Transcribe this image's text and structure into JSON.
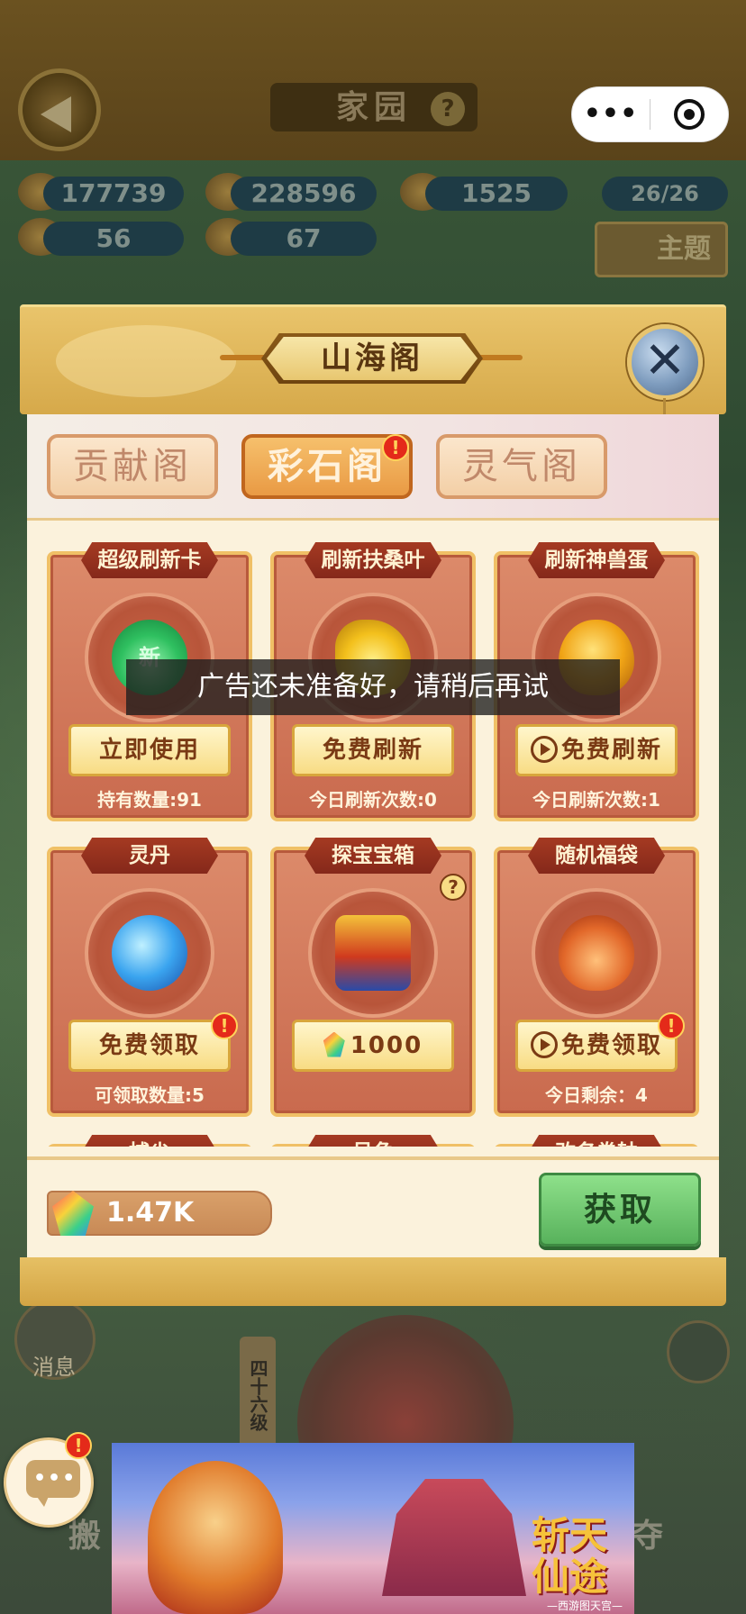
{
  "background": {
    "home_title": "家园",
    "help_glyph": "?",
    "capsule": {
      "more": "•••"
    },
    "resources": [
      "177739",
      "228596",
      "1525",
      "26/26",
      "56",
      "67"
    ],
    "theme_label": "主题",
    "message_label": "消息",
    "level_label": "四十六级",
    "left_action": "搬",
    "right_action": "夺"
  },
  "modal": {
    "title": "山海阁",
    "close_glyph": "✕",
    "tabs": [
      {
        "label": "贡献阁",
        "active": false
      },
      {
        "label": "彩石阁",
        "active": true,
        "badge": "!"
      },
      {
        "label": "灵气阁",
        "active": false
      }
    ],
    "items": [
      {
        "title": "超级刷新卡",
        "icon": "green-fire-icon",
        "tag": "新",
        "button": "立即使用",
        "footer": "持有数量:91"
      },
      {
        "title": "刷新扶桑叶",
        "icon": "golden-leaf-icon",
        "button": "免费刷新",
        "footer": "今日刷新次数:0"
      },
      {
        "title": "刷新神兽蛋",
        "icon": "golden-egg-icon",
        "button": "免费刷新",
        "button_icon": "play-video-icon",
        "footer": "今日刷新次数:1"
      },
      {
        "title": "灵丹",
        "icon": "blue-pill-icon",
        "button": "免费领取",
        "badge": "!",
        "footer": "可领取数量:5"
      },
      {
        "title": "探宝宝箱",
        "icon": "treasure-chest-icon",
        "button": "1000",
        "button_icon": "gem-icon",
        "help": "?",
        "footer": ""
      },
      {
        "title": "随机福袋",
        "icon": "lucky-bag-icon",
        "button": "免费领取",
        "button_icon": "play-video-icon",
        "badge": "!",
        "footer": "今日剩余：4"
      }
    ],
    "partial_titles": [
      "捕尘",
      "号角",
      "改名卷轴"
    ],
    "currency": "1.47K",
    "obtain_button": "获取"
  },
  "toast": "广告还未准备好，请稍后再试",
  "chat": {
    "dots": "•••",
    "badge": "!"
  },
  "ad": {
    "logo": "斩天仙途",
    "sub": "—西游图天宫—"
  },
  "colors": {
    "modal_gold": "#e9c46b",
    "card_red": "#c96a4e",
    "active_tab": "#e99a44",
    "obtain_green": "#58b25c",
    "badge_red": "#e42a1a"
  }
}
